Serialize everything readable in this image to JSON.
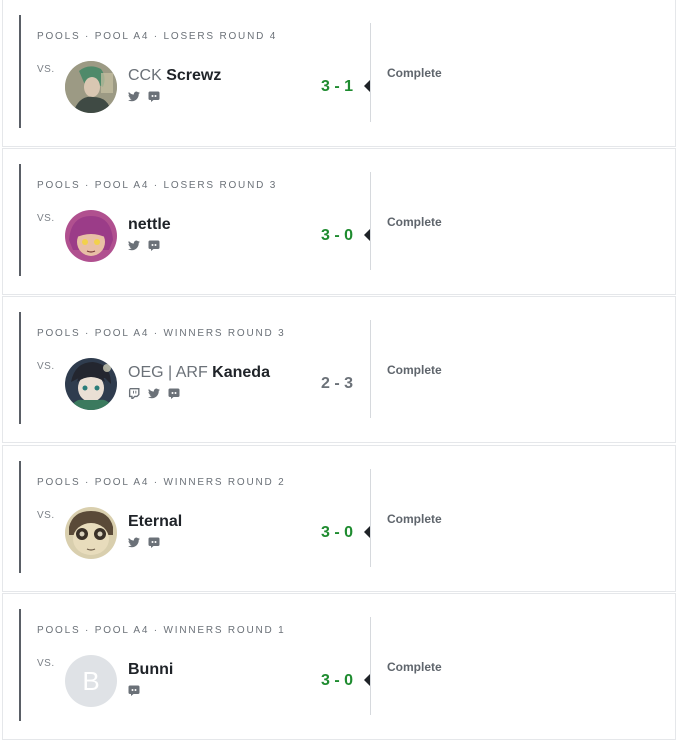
{
  "vs_label": "VS.",
  "status_label": "Complete",
  "matches": [
    {
      "round": "POOLS · POOL A4 · LOSERS ROUND 4",
      "prefix": "CCK",
      "name": "Screwz",
      "score": "3 - 1",
      "result": "win",
      "socials": [
        "twitter-icon",
        "discord-icon"
      ]
    },
    {
      "round": "POOLS · POOL A4 · LOSERS ROUND 3",
      "prefix": "",
      "name": "nettle",
      "score": "3 - 0",
      "result": "win",
      "socials": [
        "twitter-icon",
        "discord-icon"
      ]
    },
    {
      "round": "POOLS · POOL A4 · WINNERS ROUND 3",
      "prefix": "OEG | ARF",
      "name": "Kaneda",
      "score": "2 - 3",
      "result": "loss",
      "socials": [
        "twitch-icon",
        "twitter-icon",
        "discord-icon"
      ]
    },
    {
      "round": "POOLS · POOL A4 · WINNERS ROUND 2",
      "prefix": "",
      "name": "Eternal",
      "score": "3 - 0",
      "result": "win",
      "socials": [
        "twitter-icon",
        "discord-icon"
      ]
    },
    {
      "round": "POOLS · POOL A4 · WINNERS ROUND 1",
      "prefix": "",
      "name": "Bunni",
      "avatar_letter": "B",
      "score": "3 - 0",
      "result": "win",
      "socials": [
        "discord-icon"
      ]
    }
  ],
  "colors": {
    "win": "#1e8b2f",
    "loss": "#6b7178",
    "text": "#1f2328",
    "accent_bar": "#5a5f66"
  }
}
